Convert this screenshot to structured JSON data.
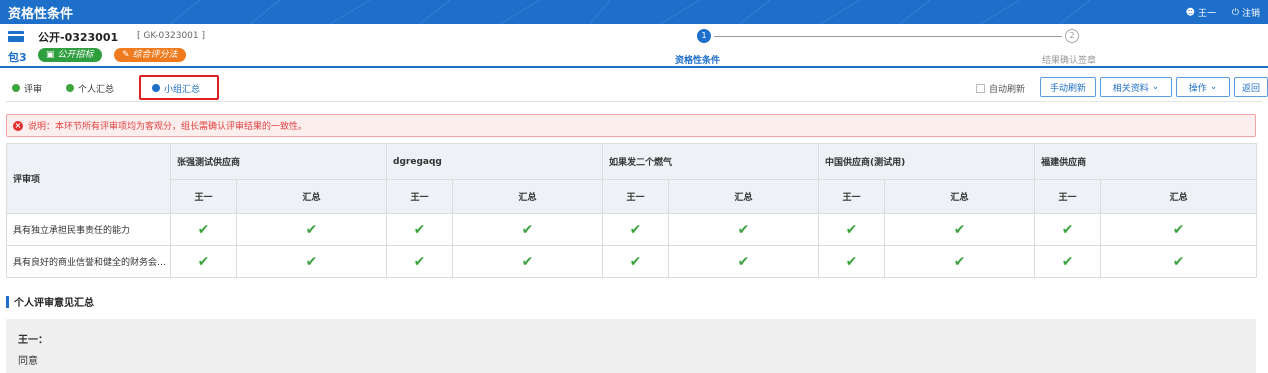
{
  "header": {
    "title": "资格性条件",
    "user": "王一",
    "logout": "注销"
  },
  "project": {
    "code": "公开-0323001",
    "subcode": "[ GK-0323001 ]",
    "package": "包3",
    "badge_method": "公开招标",
    "badge_eval": "综合评分法"
  },
  "steps": [
    {
      "num": "1",
      "label": "资格性条件",
      "active": true
    },
    {
      "num": "2",
      "label": "结果确认签章",
      "active": false
    }
  ],
  "tabs": [
    {
      "label": "评审"
    },
    {
      "label": "个人汇总"
    },
    {
      "label": "小组汇总"
    }
  ],
  "toolbar": {
    "auto_refresh": "自动刷新",
    "manual_refresh": "手动刷新",
    "related_docs": "相关资料",
    "operations": "操作",
    "back": "返回"
  },
  "notice": "说明：本环节所有评审项均为客观分，组长需确认评审结果的一致性。",
  "table": {
    "corner": "评审项",
    "suppliers": [
      "张强测试供应商",
      "dgregaqg",
      "如果发二个燃气",
      "中国供应商(测试用)",
      "福建供应商"
    ],
    "sub_headers": [
      "王一",
      "汇总"
    ],
    "rows": [
      {
        "item": "具有独立承担民事责任的能力",
        "marks": [
          "✔",
          "✔",
          "✔",
          "✔",
          "✔",
          "✔",
          "✔",
          "✔",
          "✔",
          "✔"
        ]
      },
      {
        "item": "具有良好的商业信誉和健全的财务会…",
        "marks": [
          "✔",
          "✔",
          "✔",
          "✔",
          "✔",
          "✔",
          "✔",
          "✔",
          "✔",
          "✔"
        ]
      }
    ]
  },
  "summary": {
    "title": "个人评审意见汇总",
    "reviewer": "王一：",
    "opinion": "同意"
  },
  "colors": {
    "primary": "#1e6fc9",
    "success": "#3da53d",
    "danger": "#e03030",
    "orange": "#f07a1e"
  }
}
